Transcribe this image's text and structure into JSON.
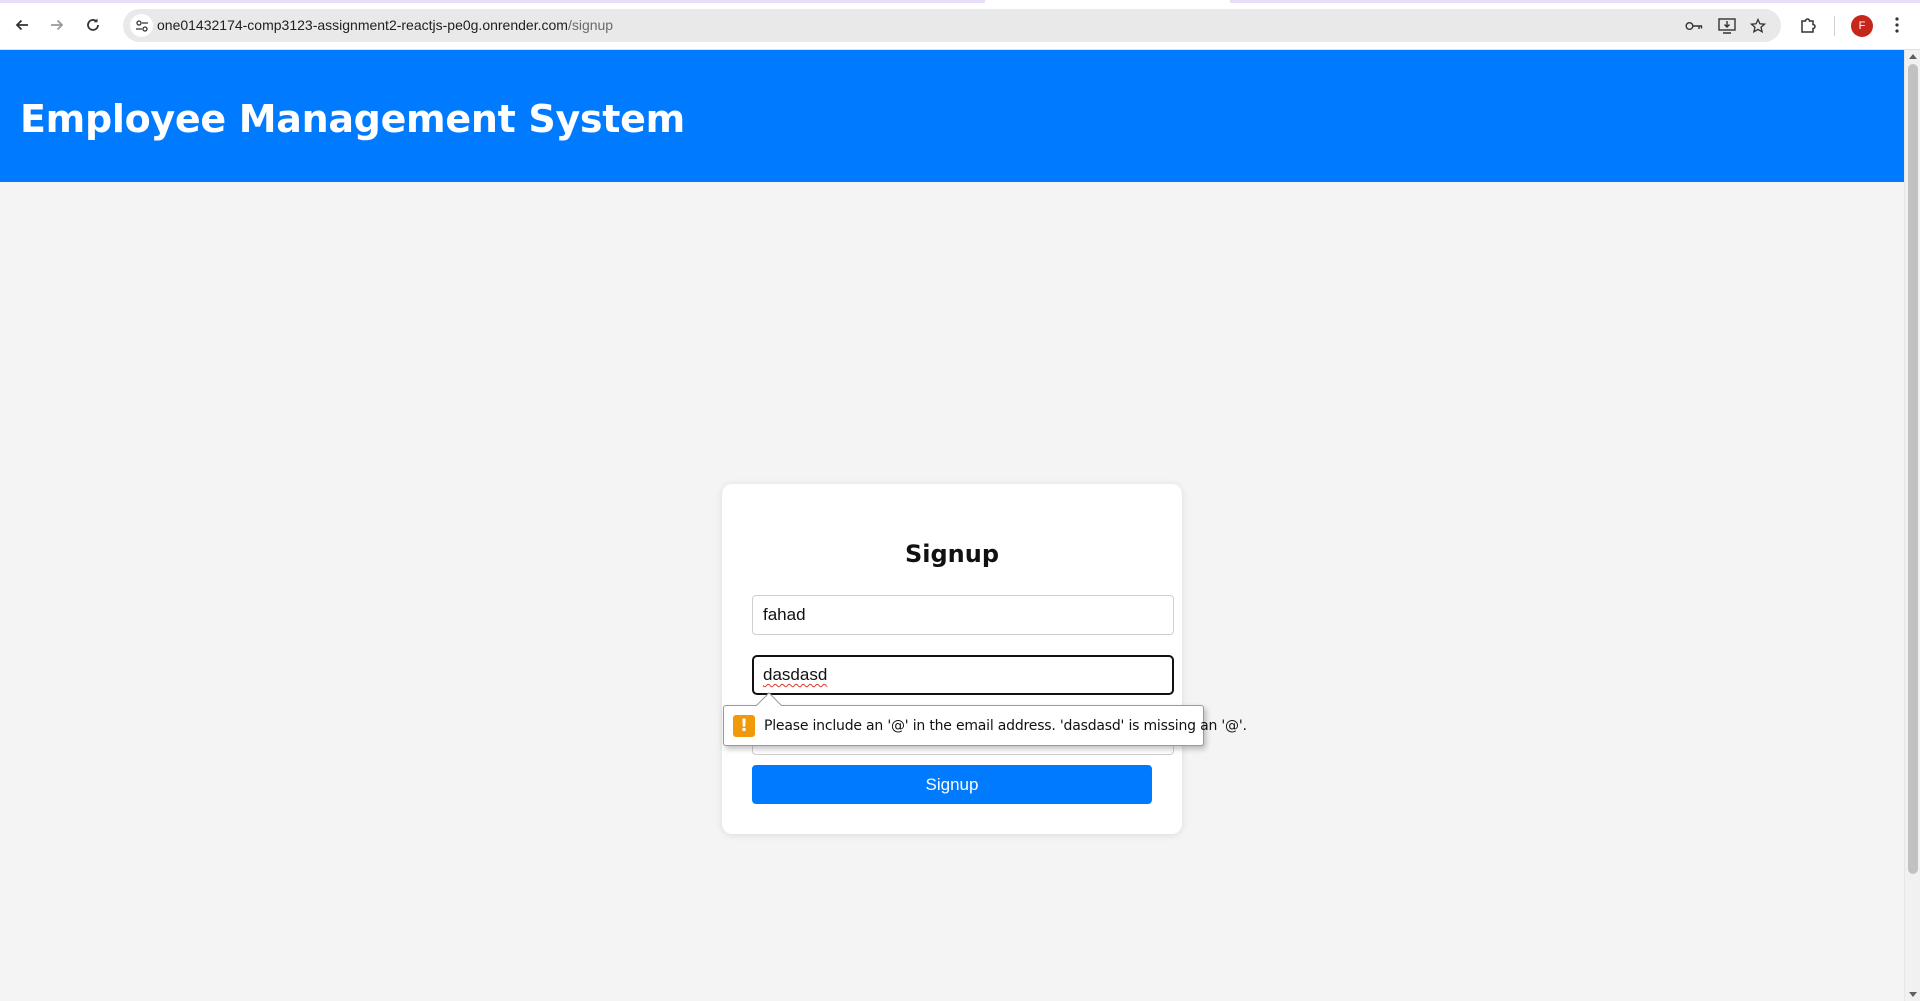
{
  "browser": {
    "url_host": "one01432174-comp3123-assignment2-reactjs-pe0g.onrender.com",
    "url_path": "/signup",
    "profile_initial": "F",
    "icons": {
      "back": "arrow-left-icon",
      "forward": "arrow-right-icon",
      "reload": "reload-icon",
      "site_info": "site-settings-icon",
      "password": "key-icon",
      "install": "install-app-icon",
      "bookmark": "star-icon",
      "extensions": "puzzle-icon",
      "menu": "more-vert-icon"
    }
  },
  "header": {
    "title": "Employee Management System",
    "background": "#007bff"
  },
  "signup_form": {
    "title": "Signup",
    "username_value": "fahad",
    "email_value": "dasdasd",
    "button_label": "Signup",
    "button_color": "#007bff"
  },
  "validation_tooltip": {
    "icon": "warning-icon",
    "icon_glyph": "!",
    "icon_color": "#f19a09",
    "message": "Please include an '@' in the email address. 'dasdasd' is missing an '@'."
  }
}
